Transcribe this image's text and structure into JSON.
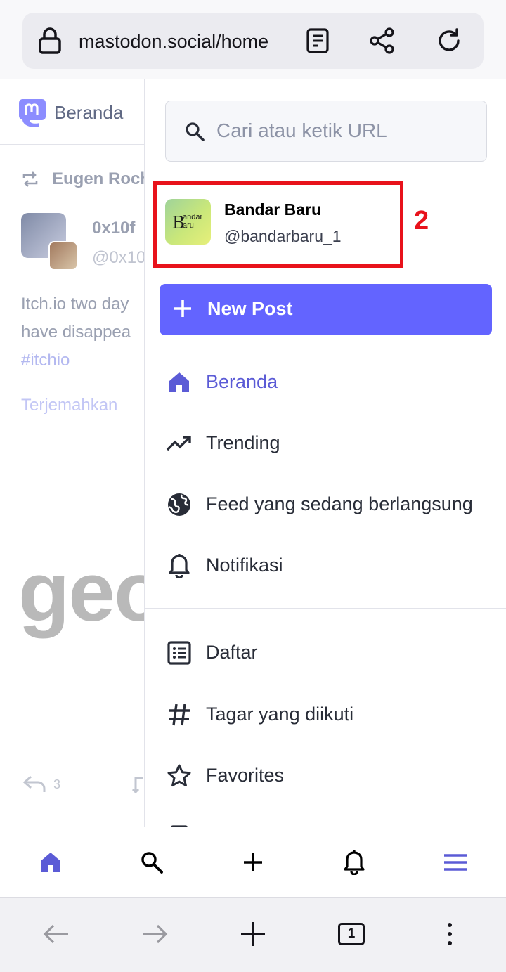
{
  "browser": {
    "url": "mastodon.social/home",
    "tab_count": "1"
  },
  "background": {
    "header_title": "Beranda",
    "boost_by": "Eugen Roch",
    "post_author": "0x10f",
    "post_handle": "@0x10",
    "post_text_1": "Itch.io two day",
    "post_text_2": "have disappea",
    "hashtag": "#itchio",
    "translate": "Terjemahkan",
    "preview_text": "geo",
    "reply_count": "3"
  },
  "panel": {
    "search_placeholder": "Cari atau ketik URL",
    "account": {
      "name": "Bandar Baru",
      "handle": "@bandarbaru_1",
      "avatar_big": "B",
      "avatar_small_1": "andar",
      "avatar_small_2": "aru"
    },
    "annotation": "2",
    "new_post": "New Post",
    "nav": [
      {
        "label": "Beranda",
        "icon": "home-icon",
        "active": true
      },
      {
        "label": "Trending",
        "icon": "trending-icon",
        "active": false
      },
      {
        "label": "Feed yang sedang berlangsung",
        "icon": "globe-icon",
        "active": false
      },
      {
        "label": "Notifikasi",
        "icon": "bell-icon",
        "active": false
      },
      {
        "label": "Daftar",
        "icon": "list-icon",
        "active": false
      },
      {
        "label": "Tagar yang diikuti",
        "icon": "hashtag-icon",
        "active": false
      },
      {
        "label": "Favorites",
        "icon": "star-icon",
        "active": false
      }
    ]
  },
  "colors": {
    "accent": "#6364ff",
    "active_nav": "#5b5bd6",
    "annotation_red": "#e8121b"
  }
}
